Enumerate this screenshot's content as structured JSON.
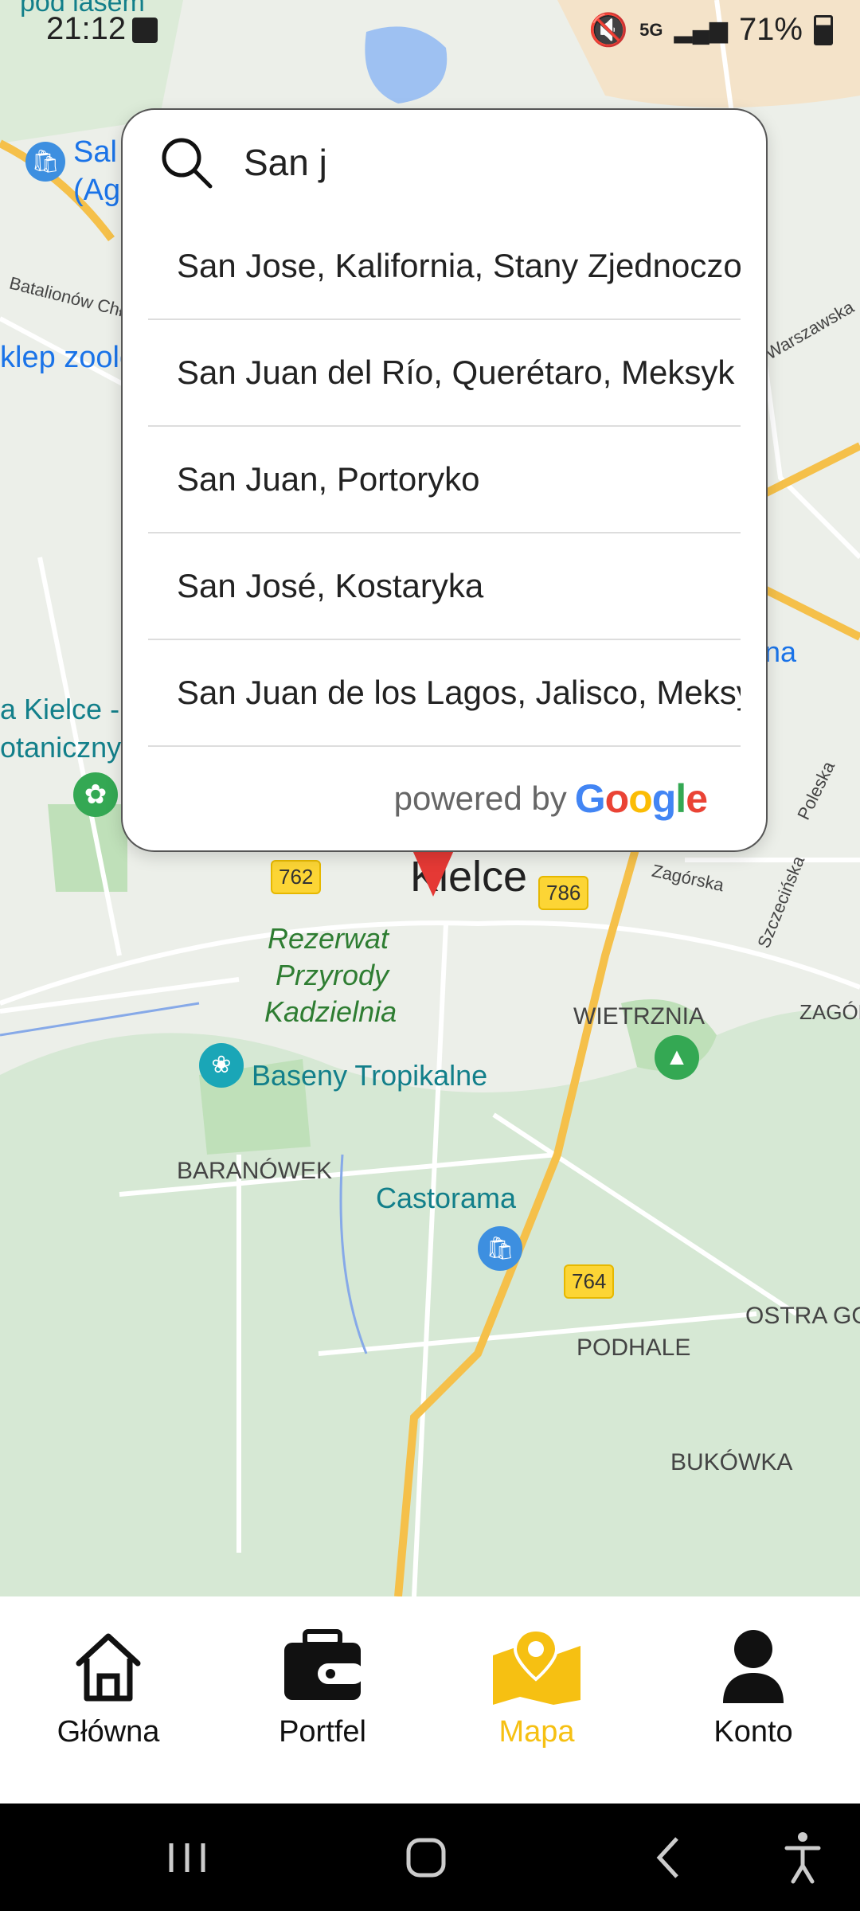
{
  "status_bar": {
    "time": "21:12",
    "battery": "71%",
    "network": "5G"
  },
  "map": {
    "labels": {
      "top_left_partial": "pod lasem",
      "salon": "Sal",
      "salon2": "(Ag",
      "batalionow": "Batalionów Chł",
      "sklep": "klep zoolo",
      "warszawska": "Warszawska",
      "kielce_park": "a Kielce -",
      "botaniczny": "otaniczny",
      "na": "na",
      "kielce_city": "Kielce",
      "rezerwat": "Rezerwat",
      "przyrody": "Przyrody",
      "kadzielnia": "Kadzielnia",
      "baseny": "Baseny Tropikalne",
      "wietrznia": "WIETRZNIA",
      "zagorze": "ZAGÓR",
      "zagorska": "Zagórska",
      "szczecinska": "Szczecińska",
      "poleska": "Poleska",
      "baranowek": "BARANÓWEK",
      "castorama": "Castorama",
      "ostra_gora": "OSTRA GO",
      "podhale": "PODHALE",
      "bukowka": "BUKÓWKA"
    },
    "road_shields": [
      "762",
      "786",
      "764"
    ]
  },
  "search": {
    "query": "San j",
    "results": [
      "San Jose, Kalifornia, Stany Zjednoczone",
      "San Juan del Río, Querétaro, Meksyk",
      "San Juan, Portoryko",
      "San José, Kostaryka",
      "San Juan de los Lagos, Jalisco, Meksyk"
    ],
    "powered_by": "powered by",
    "google": [
      "G",
      "o",
      "o",
      "g",
      "l",
      "e"
    ],
    "google_colors": [
      "#4285F4",
      "#EA4335",
      "#FBBC05",
      "#4285F4",
      "#34A853",
      "#EA4335"
    ]
  },
  "bottom_nav": {
    "items": [
      {
        "label": "Główna",
        "icon": "home-icon"
      },
      {
        "label": "Portfel",
        "icon": "wallet-icon"
      },
      {
        "label": "Mapa",
        "icon": "map-pin-icon"
      },
      {
        "label": "Konto",
        "icon": "person-icon"
      }
    ],
    "active_color": "#f6c012"
  }
}
